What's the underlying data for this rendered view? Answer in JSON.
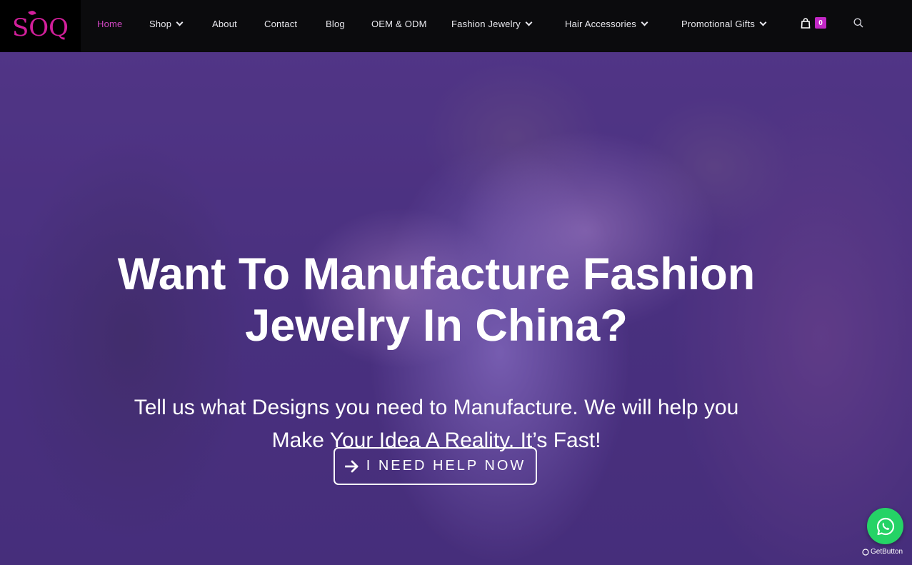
{
  "brand": {
    "logo_text": "SOQ",
    "accent_color": "#d21f9b"
  },
  "nav": {
    "items": [
      {
        "label": "Home",
        "active": true,
        "dropdown": false
      },
      {
        "label": "Shop",
        "active": false,
        "dropdown": true
      },
      {
        "label": "About",
        "active": false,
        "dropdown": false
      },
      {
        "label": "Contact",
        "active": false,
        "dropdown": false
      },
      {
        "label": "Blog",
        "active": false,
        "dropdown": false
      },
      {
        "label": "OEM & ODM",
        "active": false,
        "dropdown": false
      },
      {
        "label": "Fashion Jewelry",
        "active": false,
        "dropdown": true
      },
      {
        "label": "Hair Accessories",
        "active": false,
        "dropdown": true
      },
      {
        "label": "Promotional Gifts",
        "active": false,
        "dropdown": true
      }
    ],
    "cart_icon": "shopping-bag-icon",
    "cart_count": "0",
    "search_icon": "search-icon"
  },
  "hero": {
    "title_line1": "Want To Manufacture Fashion",
    "title_line2": "Jewelry In China?",
    "subtitle_line1": "Tell us what Designs you need to Manufacture. We will help you",
    "subtitle_line2": "Make Your Idea A Reality. It’s Fast!",
    "cta_label": "I NEED HELP NOW",
    "cta_icon": "arrow-right-icon"
  },
  "whatsapp": {
    "icon": "whatsapp-icon",
    "credit": "GetButton",
    "color": "#25d366"
  }
}
